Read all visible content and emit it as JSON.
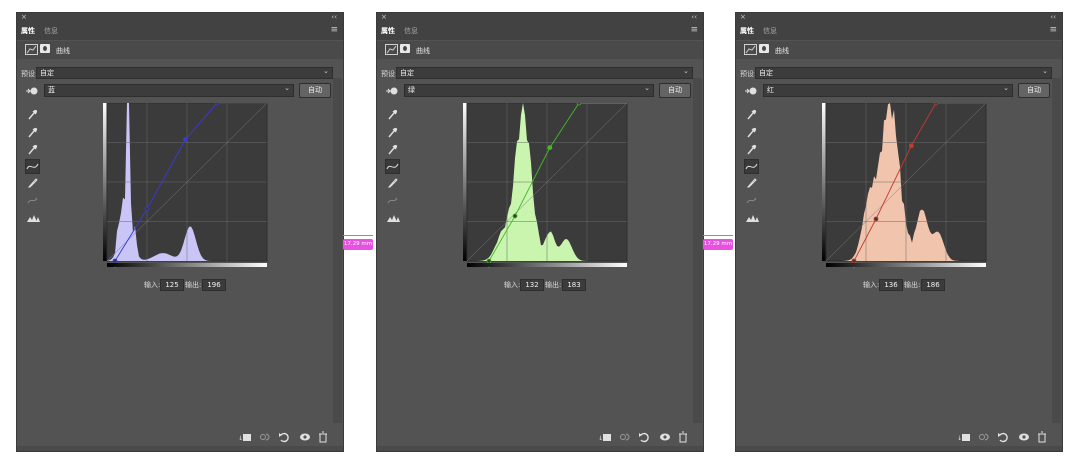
{
  "panels": [
    {
      "close": "×",
      "collapse": "‹‹",
      "menu": "≡",
      "tabs": [
        "属性",
        "信息"
      ],
      "header_title": "曲线",
      "preset_label": "预设:",
      "preset_value": "自定",
      "channel": "蓝",
      "auto_label": "自动",
      "input_label": "输入:",
      "input_value": "125",
      "output_label": "输出:",
      "output_value": "196",
      "hist_color": "#c9c6f7",
      "curve_color": "#3a3ad6"
    },
    {
      "close": "×",
      "collapse": "‹‹",
      "menu": "≡",
      "tabs": [
        "属性",
        "信息"
      ],
      "header_title": "曲线",
      "preset_label": "预设:",
      "preset_value": "自定",
      "channel": "绿",
      "auto_label": "自动",
      "input_label": "输入:",
      "input_value": "132",
      "output_label": "输出:",
      "output_value": "183",
      "hist_color": "#c9f5ae",
      "curve_color": "#45b82a"
    },
    {
      "close": "×",
      "collapse": "‹‹",
      "menu": "≡",
      "tabs": [
        "属性",
        "信息"
      ],
      "header_title": "曲线",
      "preset_label": "预设:",
      "preset_value": "自定",
      "channel": "红",
      "auto_label": "自动",
      "input_label": "输入:",
      "input_value": "136",
      "output_label": "输出:",
      "output_value": "186",
      "hist_color": "#f1c4ad",
      "curve_color": "#c23b2e"
    }
  ],
  "measurements": [
    {
      "label": "17.29 mm"
    },
    {
      "label": "17.29 mm"
    }
  ],
  "measure_color": "#e651e0"
}
